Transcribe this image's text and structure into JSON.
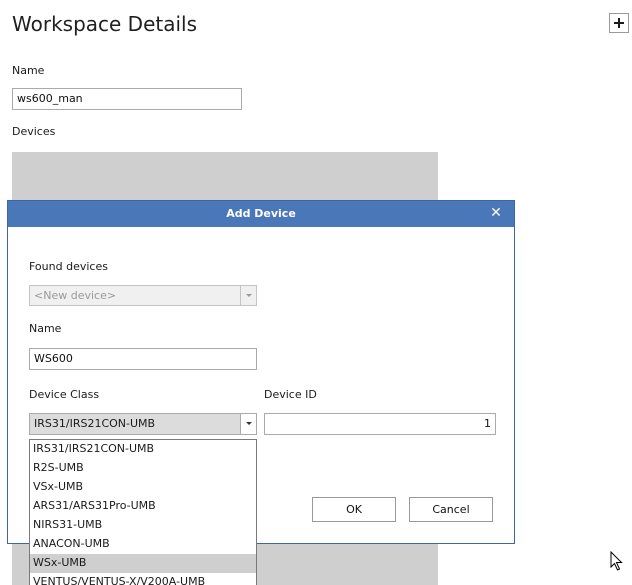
{
  "page": {
    "title": "Workspace Details",
    "name_label": "Name",
    "name_value": "ws600_man",
    "devices_label": "Devices"
  },
  "dialog": {
    "title": "Add Device",
    "close_glyph": "✕",
    "found_devices_label": "Found devices",
    "found_devices_value": "<New device>",
    "name_label": "Name",
    "name_value": "WS600",
    "device_class_label": "Device Class",
    "device_class_value": "IRS31/IRS21CON-UMB",
    "device_id_label": "Device ID",
    "device_id_value": "1",
    "ok_label": "OK",
    "cancel_label": "Cancel"
  },
  "device_class_options": [
    "IRS31/IRS21CON-UMB",
    "R2S-UMB",
    "VSx-UMB",
    "ARS31/ARS31Pro-UMB",
    "NIRS31-UMB",
    "ANACON-UMB",
    "WSx-UMB",
    "VENTUS/VENTUS-X/V200A-UMB"
  ],
  "highlighted_option": "WSx-UMB",
  "colors": {
    "titlebar": "#4a77b8",
    "devices_area": "#cfcfcf",
    "highlight": "#cfcfcf"
  },
  "icons": {
    "add": "plus-icon",
    "close": "close-icon",
    "dropdown": "chevron-down-icon",
    "pointer": "mouse-pointer-icon"
  }
}
